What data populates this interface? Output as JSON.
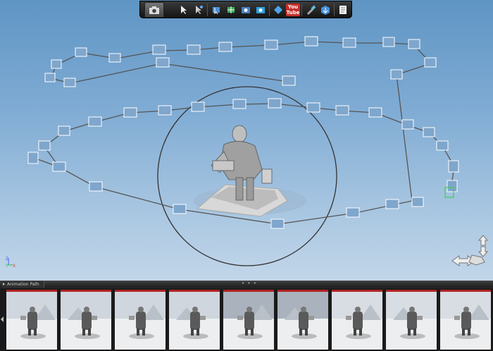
{
  "toolbar": {
    "icons": [
      "camera-icon",
      "select-pointer-icon",
      "select-pointer-alt-icon",
      "pick-target-icon",
      "move-camera-icon",
      "camera-path-icon",
      "snapshot-camera-icon",
      "diamond-keyframe-icon",
      "youtube-icon",
      "eyedropper-icon",
      "export-package-icon",
      "notes-icon"
    ],
    "youtube_label": "You Tube"
  },
  "viewport": {
    "axis": {
      "x": "X",
      "y": "Y",
      "z": "Z",
      "x_color": "#e03030",
      "y_color": "#30c030",
      "z_color": "#4060ff"
    },
    "background_top": "#5f95c4",
    "background_bottom": "#c2d6e9"
  },
  "filmstrip": {
    "tab_label": "Animation Path",
    "grip": "• • •",
    "thumbnails_count": 9,
    "accent_color": "#b02222"
  }
}
